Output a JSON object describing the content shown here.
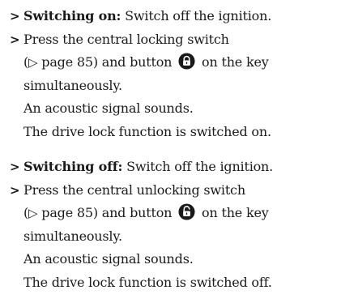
{
  "arrow": ">",
  "triangle": "▷",
  "sections": [
    {
      "switch_label": "Switching on:",
      "switch_text": " Switch off the ignition.",
      "press_line_1": "Press the central locking switch",
      "page_ref_open": "(",
      "page_ref": " page 85) and button",
      "key_text": " on the key",
      "simultaneously": "simultaneously.",
      "acoustic": "An acoustic signal sounds.",
      "result": "The drive lock function is switched on.",
      "icon": "lock-closed-icon"
    },
    {
      "switch_label": "Switching off:",
      "switch_text": " Switch off the ignition.",
      "press_line_1": "Press the central unlocking switch",
      "page_ref_open": "(",
      "page_ref": " page 85) and button",
      "key_text": " on the key",
      "simultaneously": "simultaneously.",
      "acoustic": "An acoustic signal sounds.",
      "result": "The drive lock function is switched off.",
      "icon": "lock-open-icon"
    }
  ]
}
